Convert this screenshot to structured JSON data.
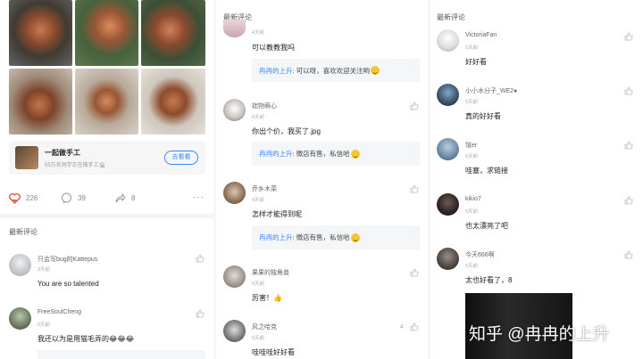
{
  "post": {
    "creator_name": "一起做手工",
    "creator_sub": "55万名同学正在做手工🏚",
    "follow_label": "去看看",
    "likes": "226",
    "comments": "39",
    "shares": "8",
    "more": "···"
  },
  "section_title": "最新评论",
  "col1_comments": [
    {
      "user": "只会写bug的Kattepus",
      "time": "3天前",
      "text": "You are so talented"
    },
    {
      "user": "FreeSoulCheng",
      "time": "6天前",
      "text": "我还以为是用猫毛弄的😂😂😂"
    }
  ],
  "col2_comments": [
    {
      "user": "",
      "time": "4天前",
      "text": "可以教教我吗",
      "reply_name": "冉冉的上升",
      "reply_text": ": 可以呀，喜欢欢迎关注哟"
    },
    {
      "user": "拙物萌心",
      "time": "6天前",
      "text": "你出个价，我买了.jpg",
      "reply_name": "冉冉的上升",
      "reply_text": ": 微店有售，私信哈"
    },
    {
      "user": "乔乡木菜",
      "time": "4天前",
      "text": "怎样才能得到呢",
      "reply_name": "冉冉的上升",
      "reply_text": ": 微店有售，私信哈"
    },
    {
      "user": "果果的独角兽",
      "time": "6天前",
      "text": "厉害！👍"
    },
    {
      "user": "风之哈克",
      "time": "6天前",
      "text": "哇哇哇好好看",
      "likes": "4"
    }
  ],
  "col3_comments": [
    {
      "user": "VictoriaFan",
      "time": "5天前",
      "text": "好好看"
    },
    {
      "user": "小小水分子_WE2●",
      "time": "5天前",
      "text": "真的好好看"
    },
    {
      "user": "瑄er",
      "time": "5天前",
      "text": "哇塞，求链接"
    },
    {
      "user": "kikio7",
      "time": "5天前",
      "text": "也太漂亮了吧"
    },
    {
      "user": "今天666啊",
      "time": "5天前",
      "text": "太也好看了，8"
    }
  ],
  "watermark": "知乎 @冉冉的上升",
  "colors": {
    "accent": "#3b86f7",
    "secondary": "#999999",
    "reply_bg": "#f5f6f7"
  },
  "icons": [
    "like-icon",
    "comment-icon",
    "share-icon",
    "thumb-up-icon"
  ]
}
